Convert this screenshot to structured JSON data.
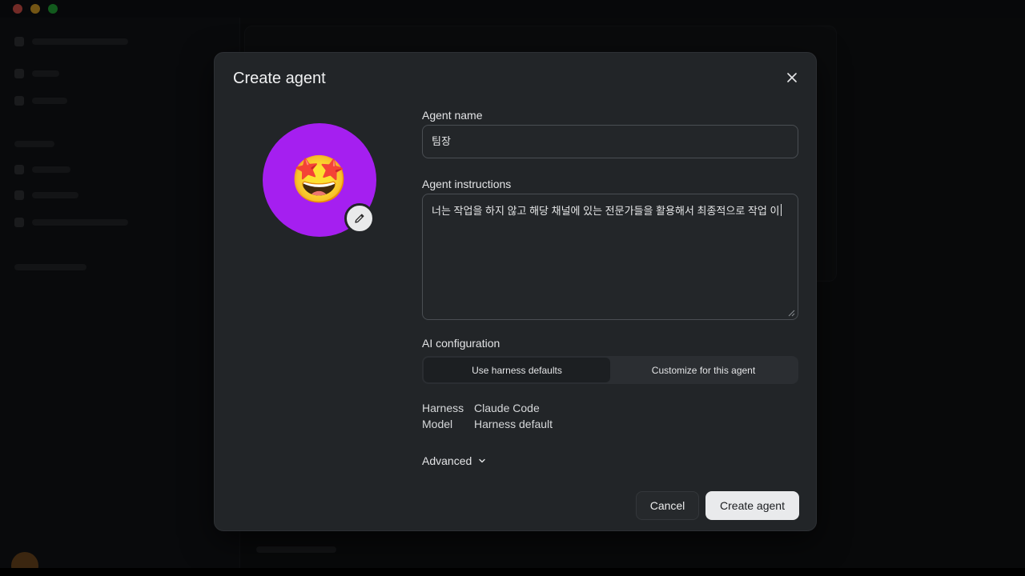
{
  "modal": {
    "title": "Create agent",
    "avatar_emoji": "🤩",
    "avatar_color": "#a51ff0",
    "agent_name_label": "Agent name",
    "agent_name_value": "팀장",
    "instructions_label": "Agent instructions",
    "instructions_value": "너는 작업을 하지 않고 해당 채널에 있는 전문가들을 활용해서 최종적으로 작업 이",
    "ai_config_label": "AI configuration",
    "ai_config_options": [
      "Use harness defaults",
      "Customize for this agent"
    ],
    "ai_config_selected": "Use harness defaults",
    "details": [
      {
        "key": "Harness",
        "value": "Claude Code"
      },
      {
        "key": "Model",
        "value": "Harness default"
      }
    ],
    "advanced_label": "Advanced",
    "cancel_label": "Cancel",
    "create_label": "Create agent"
  },
  "icons": [
    "close-icon",
    "pencil-icon",
    "chevron-down-icon",
    "resize-handle-icon"
  ]
}
